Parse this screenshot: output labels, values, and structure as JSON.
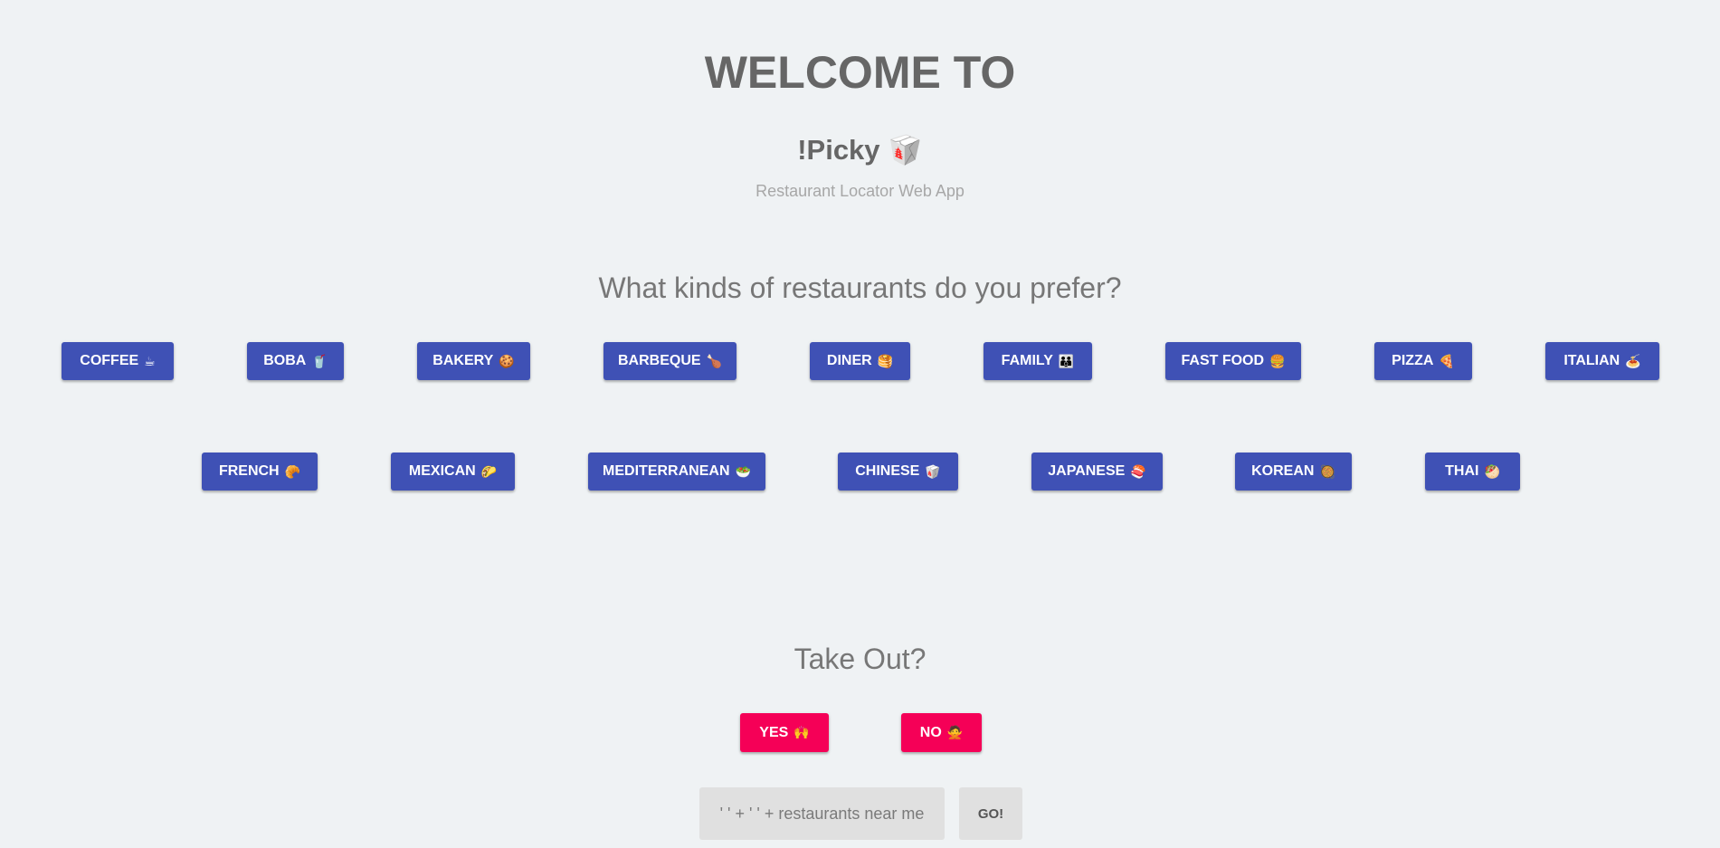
{
  "header": {
    "welcome": "WELCOME TO",
    "app_name": "!Picky",
    "app_icon": "🥡",
    "subtitle": "Restaurant Locator Web App"
  },
  "preferences": {
    "question": "What kinds of restaurants do you prefer?",
    "categories": [
      {
        "label": "COFFEE",
        "emoji": "☕"
      },
      {
        "label": "BOBA",
        "emoji": "🥤"
      },
      {
        "label": "BAKERY",
        "emoji": "🍪"
      },
      {
        "label": "BARBEQUE",
        "emoji": "🍗"
      },
      {
        "label": "DINER",
        "emoji": "🥞"
      },
      {
        "label": "FAMILY",
        "emoji": "👪"
      },
      {
        "label": "FAST FOOD",
        "emoji": "🍔"
      },
      {
        "label": "PIZZA",
        "emoji": "🍕"
      },
      {
        "label": "ITALIAN",
        "emoji": "🍝"
      },
      {
        "label": "FRENCH",
        "emoji": "🥐"
      },
      {
        "label": "MEXICAN",
        "emoji": "🌮"
      },
      {
        "label": "MEDITERRANEAN",
        "emoji": "🥗"
      },
      {
        "label": "CHINESE",
        "emoji": "🥡"
      },
      {
        "label": "JAPANESE",
        "emoji": "🍣"
      },
      {
        "label": "KOREAN",
        "emoji": "🥘"
      },
      {
        "label": "THAI",
        "emoji": "🥙"
      }
    ]
  },
  "takeout": {
    "question": "Take Out?",
    "yes": {
      "label": "YES",
      "emoji": "🙌"
    },
    "no": {
      "label": "NO",
      "emoji": "🙅"
    }
  },
  "search": {
    "query": "' ' + ' ' + restaurants near me",
    "go_label": "GO!"
  },
  "colors": {
    "primary": "#3f51b5",
    "accent": "#f50057",
    "background": "#eff2f4"
  }
}
